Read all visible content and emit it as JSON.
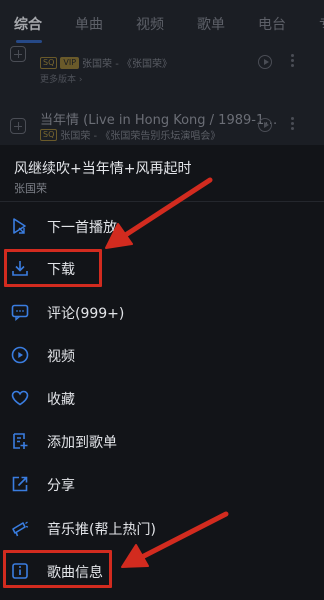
{
  "tabs": [
    {
      "label": "综合",
      "active": true
    },
    {
      "label": "单曲",
      "active": false
    },
    {
      "label": "视频",
      "active": false
    },
    {
      "label": "歌单",
      "active": false
    },
    {
      "label": "电台",
      "active": false
    },
    {
      "label": "专",
      "active": false
    }
  ],
  "background_songs": [
    {
      "title": "",
      "badges": [
        "SQ",
        "VIP"
      ],
      "artist_album": "张国荣 - 《张国荣》",
      "more_versions": "更多版本 ›"
    },
    {
      "title": "当年情 (Live in Hong Kong / 1989-1…",
      "badges": [
        "SQ"
      ],
      "artist_album": "张国荣 - 《张国荣告别乐坛演唱会》",
      "more_versions": ""
    }
  ],
  "sheet": {
    "title": "风继续吹+当年情+风再起时",
    "subtitle": "张国荣",
    "items": [
      {
        "label": "下一首播放",
        "icon": "play-next-icon"
      },
      {
        "label": "下载",
        "icon": "download-icon"
      },
      {
        "label": "评论(999+)",
        "icon": "comment-icon"
      },
      {
        "label": "视频",
        "icon": "video-icon"
      },
      {
        "label": "收藏",
        "icon": "heart-icon"
      },
      {
        "label": "添加到歌单",
        "icon": "add-to-playlist-icon"
      },
      {
        "label": "分享",
        "icon": "share-icon"
      },
      {
        "label": "音乐推(帮上热门)",
        "icon": "promote-icon"
      },
      {
        "label": "歌曲信息",
        "icon": "song-info-icon"
      }
    ]
  },
  "annotations": {
    "color": "#d22b1f",
    "highlighted_items": [
      "下载",
      "歌曲信息"
    ]
  },
  "colors": {
    "icon_blue": "#3a7de0",
    "background": "#121418"
  }
}
